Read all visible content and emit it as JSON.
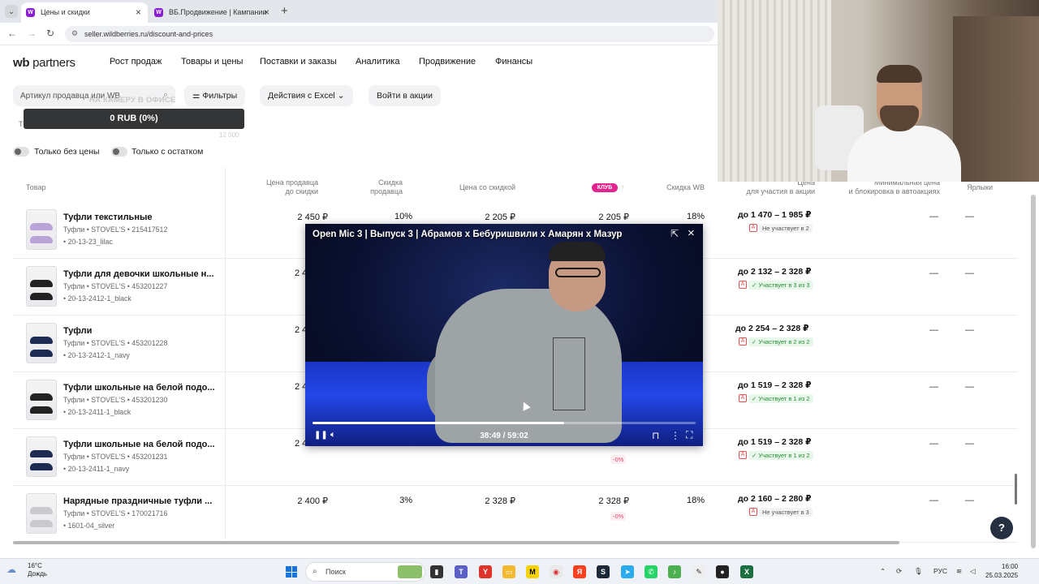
{
  "browser": {
    "tabs": [
      {
        "label": "Цены и скидки",
        "active": true
      },
      {
        "label": "ВБ.Продвижение | Кампании",
        "active": false
      }
    ],
    "url": "seller.wildberries.ru/discount-and-prices"
  },
  "header": {
    "logo_wb": "wb",
    "logo_partners": "partners",
    "nav": [
      "Рост продаж",
      "Товары и цены",
      "Поставки и заказы",
      "Аналитика",
      "Продвижение",
      "Финансы"
    ]
  },
  "filters": {
    "search_placeholder": "Артикул продавца или WB",
    "filters_button": "Фильтры",
    "excel_button": "Действия с Excel",
    "promo_button": "Войти в акции",
    "toggle_no_price": "Только без цены",
    "toggle_in_stock": "Только с остатком"
  },
  "stream_overlay": {
    "caption": "НА КАМЕРУ В ОФИСЕ",
    "donation": "0 RUB (0%)",
    "goal": "12 000"
  },
  "table": {
    "headers": {
      "product": "Товар",
      "seller_price": [
        "Цена продавца",
        "до скидки"
      ],
      "seller_discount": [
        "Скидка",
        "продавца"
      ],
      "discounted_price": "Цена со скидкой",
      "club_badge": "КЛУБ",
      "wb_discount": "Скидка WB",
      "promo_price": [
        "Цена",
        "для участия в акции"
      ],
      "min_price": [
        "Минимальная цена",
        "и блокировка в автоакциях"
      ],
      "labels": "Ярлыки"
    },
    "rows": [
      {
        "name": "Туфли текстильные",
        "brand_sku": "Туфли • STOVEL'S • 215417512",
        "article": "• 20-13-23_lilac",
        "price": "2 450 ₽",
        "discount": "10%",
        "discounted": "2 205 ₽",
        "club": "2 205 ₽",
        "club_delta": "",
        "wb": "18%",
        "range": "до 1 470 – 1 985 ₽",
        "status": "Не участвует в 2",
        "participating": false
      },
      {
        "name": "Туфли для девочки школьные н...",
        "brand_sku": "Туфли • STOVEL'S • 453201227",
        "article": "• 20-13-2412-1_black",
        "price": "2 4",
        "discount": "",
        "discounted": "",
        "club": "",
        "club_delta": "",
        "wb": "",
        "range": "до 2 132 – 2 328 ₽",
        "status": "✓ Участвует в 3 из 3",
        "participating": true
      },
      {
        "name": "Туфли",
        "brand_sku": "Туфли • STOVEL'S • 453201228",
        "article": "• 20-13-2412-1_navy",
        "price": "2 4",
        "discount": "",
        "discounted": "",
        "club": "",
        "club_delta": "",
        "wb": "",
        "range": "до 2 254 – 2 328 ₽",
        "status": "✓ Участвует в 2 из 2",
        "participating": true
      },
      {
        "name": "Туфли школьные на белой подо...",
        "brand_sku": "Туфли • STOVEL'S • 453201230",
        "article": "• 20-13-2411-1_black",
        "price": "2 4",
        "discount": "",
        "discounted": "",
        "club": "",
        "club_delta": "",
        "wb": "",
        "range": "до 1 519 – 2 328 ₽",
        "status": "✓ Участвует в 1 из 2",
        "participating": true
      },
      {
        "name": "Туфли школьные на белой подо...",
        "brand_sku": "Туфли • STOVEL'S • 453201231",
        "article": "• 20-13-2411-1_navy",
        "price": "2 4",
        "discount": "",
        "discounted": "",
        "club": "",
        "club_delta": "-0%",
        "wb": "",
        "range": "до 1 519 – 2 328 ₽",
        "status": "✓ Участвует в 1 из 2",
        "participating": true
      },
      {
        "name": "Нарядные праздничные туфли ...",
        "brand_sku": "Туфли • STOVEL'S • 170021716",
        "article": "• 1601-04_silver",
        "price": "2 400 ₽",
        "discount": "3%",
        "discounted": "2 328 ₽",
        "club": "2 328 ₽",
        "club_delta": "-0%",
        "wb": "18%",
        "range": "до 2 160 – 2 280 ₽",
        "status": "Не участвует в 3",
        "participating": false
      }
    ],
    "dash": "—"
  },
  "video": {
    "title": "Open Mic 3 | Выпуск 3 | Абрамов х Бебуришвили х Амарян х Мазур",
    "time": "38:49 / 59:02",
    "progress": 0.657
  },
  "taskbar": {
    "temp": "16°C",
    "weather": "Дождь",
    "search": "Поиск",
    "lang": "РУС",
    "time": "16:00",
    "date": "25.03.2025"
  },
  "colors": {
    "brand_purple": "#8b1dd6",
    "club_pink": "#e3248f",
    "negative": "#e05050",
    "positive": "#2a8a36"
  }
}
